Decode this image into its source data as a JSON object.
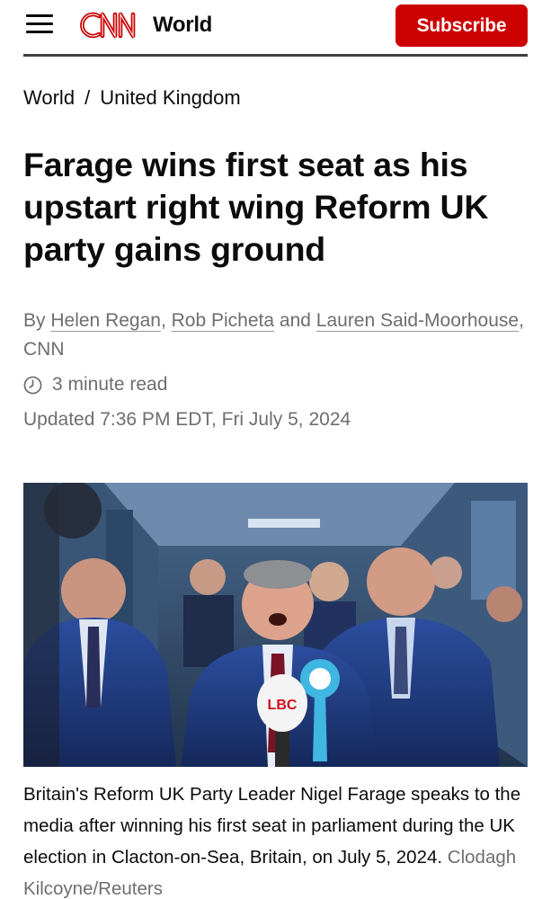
{
  "header": {
    "logo_text": "CNN",
    "section": "World",
    "subscribe_label": "Subscribe",
    "brand_color": "#cc0000"
  },
  "breadcrumb": {
    "items": [
      "World",
      "United Kingdom"
    ],
    "separator": "/"
  },
  "article": {
    "headline": "Farage wins first seat as his upstart right wing Reform UK party gains ground",
    "byline": {
      "prefix": "By",
      "authors": [
        "Helen Regan",
        "Rob Picheta",
        "Lauren Said-Moorhouse"
      ],
      "separator_1": ",",
      "separator_2": "and",
      "suffix": ", CNN"
    },
    "read_time": "3 minute read",
    "updated": "Updated 7:36 PM EDT, Fri July 5, 2024"
  },
  "image": {
    "caption": "Britain's Reform UK Party Leader Nigel Farage speaks to the media after winning his first seat in parliament during the UK election in Clacton-on-Sea, Britain, on July 5, 2024.",
    "credit": "Clodagh Kilcoyne/Reuters",
    "mic_label": "LBC"
  },
  "icons": {
    "menu": "hamburger-menu-icon",
    "clock": "clock-icon"
  }
}
